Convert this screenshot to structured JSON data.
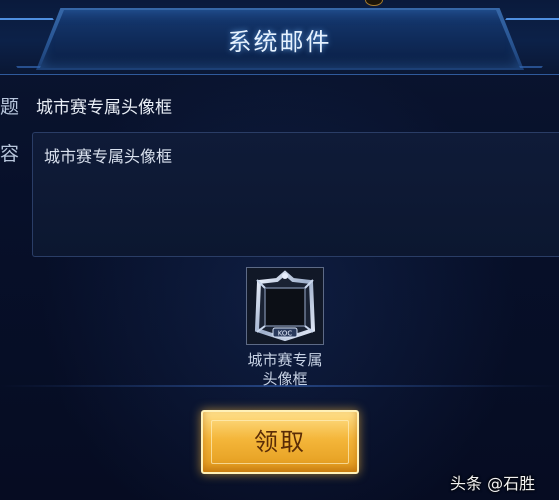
{
  "header": {
    "title": "系统邮件"
  },
  "mail": {
    "subject_label": "标题",
    "subject_label_visible": "标题",
    "subject": "城市赛专属头像框",
    "content_label": "内容",
    "content_label_visible": "内容",
    "content": "城市赛专属头像框"
  },
  "reward": {
    "icon": "avatar-frame-icon",
    "badge_text": "KOC",
    "name_line1": "城市赛专属",
    "name_line2": "头像框"
  },
  "actions": {
    "claim_label": "领取"
  },
  "watermark": {
    "text": "头条 @石胜"
  },
  "colors": {
    "accent_blue": "#4f8fe0",
    "claim_gold": "#f4b63a",
    "claim_text": "#5a2c06"
  }
}
